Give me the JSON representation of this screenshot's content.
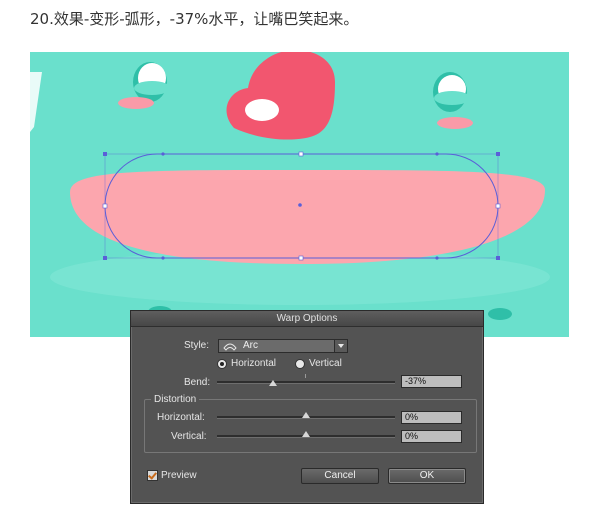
{
  "step": {
    "title": "20.效果-变形-弧形，-37%水平，让嘴巴笑起来。"
  },
  "dialog": {
    "title": "Warp Options",
    "style_label": "Style:",
    "style_value": "Arc",
    "style_icon": "arc-icon",
    "orientation": {
      "horizontal_label": "Horizontal",
      "vertical_label": "Vertical",
      "selected": "Horizontal"
    },
    "bend": {
      "label": "Bend:",
      "value": "-37%",
      "fraction": 0.315
    },
    "distortion": {
      "legend": "Distortion",
      "horizontal": {
        "label": "Horizontal:",
        "value": "0%",
        "fraction": 0.5
      },
      "vertical": {
        "label": "Vertical:",
        "value": "0%",
        "fraction": 0.5
      }
    },
    "preview": {
      "label": "Preview",
      "checked": true
    },
    "cancel_label": "Cancel",
    "ok_label": "OK"
  },
  "colors": {
    "canvas_bg": "#6ae0cc",
    "mouth": "#fca6ae",
    "nose": "#f2566f",
    "cheek": "#f99aa8",
    "eye_shadow": "#2fbfa8",
    "selection": "#5a5fd8",
    "dialog_bg": "#535353"
  }
}
